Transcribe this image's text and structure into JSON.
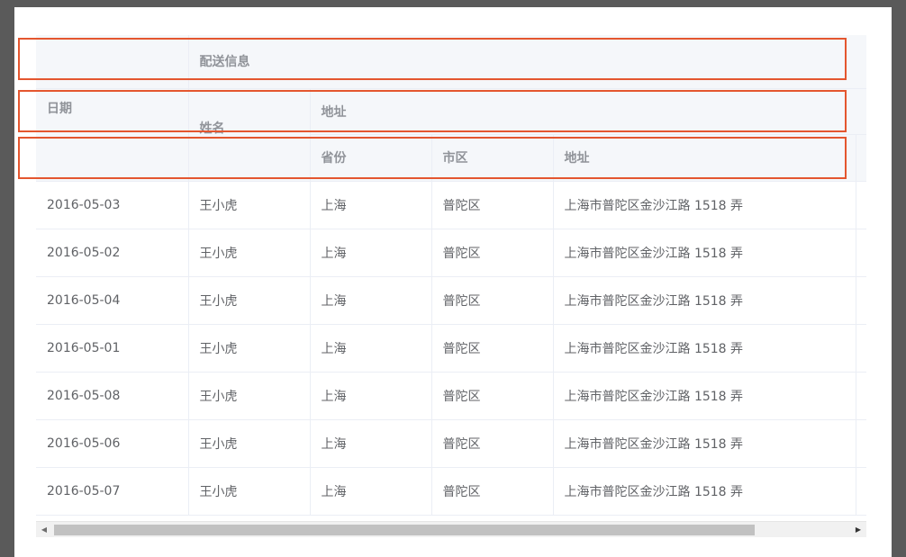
{
  "table": {
    "group_header": "配送信息",
    "columns": {
      "date": "日期",
      "name": "姓名",
      "address_group": "地址",
      "province": "省份",
      "city": "市区",
      "address": "地址"
    },
    "rows": [
      {
        "date": "2016-05-03",
        "name": "王小虎",
        "province": "上海",
        "city": "普陀区",
        "address": "上海市普陀区金沙江路 1518 弄"
      },
      {
        "date": "2016-05-02",
        "name": "王小虎",
        "province": "上海",
        "city": "普陀区",
        "address": "上海市普陀区金沙江路 1518 弄"
      },
      {
        "date": "2016-05-04",
        "name": "王小虎",
        "province": "上海",
        "city": "普陀区",
        "address": "上海市普陀区金沙江路 1518 弄"
      },
      {
        "date": "2016-05-01",
        "name": "王小虎",
        "province": "上海",
        "city": "普陀区",
        "address": "上海市普陀区金沙江路 1518 弄"
      },
      {
        "date": "2016-05-08",
        "name": "王小虎",
        "province": "上海",
        "city": "普陀区",
        "address": "上海市普陀区金沙江路 1518 弄"
      },
      {
        "date": "2016-05-06",
        "name": "王小虎",
        "province": "上海",
        "city": "普陀区",
        "address": "上海市普陀区金沙江路 1518 弄"
      },
      {
        "date": "2016-05-07",
        "name": "王小虎",
        "province": "上海",
        "city": "普陀区",
        "address": "上海市普陀区金沙江路 1518 弄"
      }
    ]
  },
  "scrollbar": {
    "left_arrow": "◀",
    "right_arrow": "▶"
  },
  "colors": {
    "highlight_border": "#e4562f",
    "header_bg": "#f5f7fa",
    "header_text": "#909399",
    "cell_text": "#606266"
  }
}
